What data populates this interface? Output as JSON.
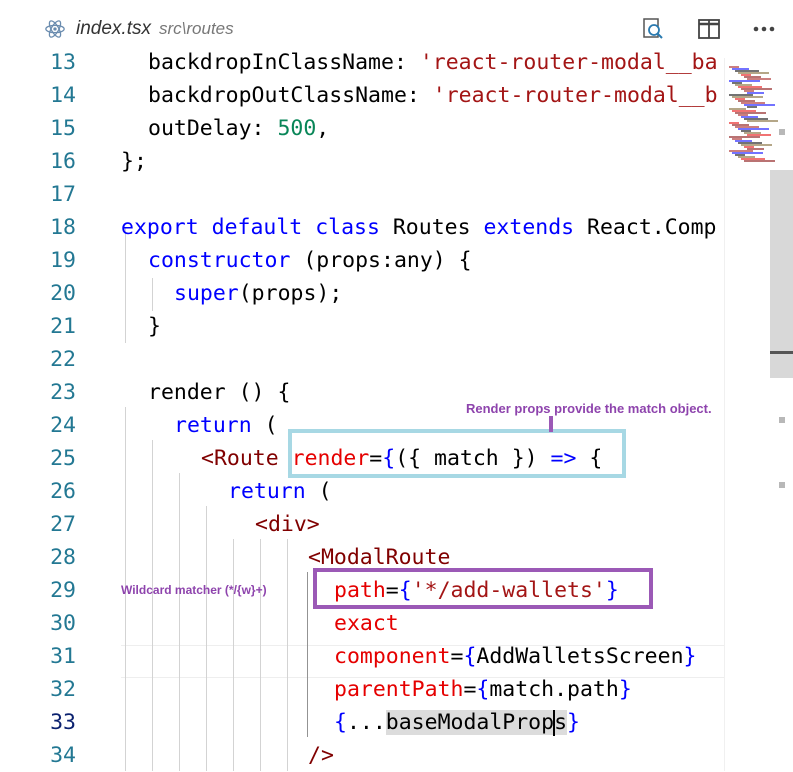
{
  "tab": {
    "filename": "index.tsx",
    "path": "src\\routes",
    "icon": "react-icon"
  },
  "toolbar": {
    "icons": [
      "search-references-icon",
      "split-editor-icon",
      "more-actions-icon"
    ]
  },
  "lines": [
    {
      "n": "13",
      "t": "backdropInClassName: 'react-router-modal__ba"
    },
    {
      "n": "14",
      "t": "backdropOutClassName: 'react-router-modal__b"
    },
    {
      "n": "15",
      "t": "outDelay: 500,"
    },
    {
      "n": "16",
      "t": "};"
    },
    {
      "n": "17",
      "t": ""
    },
    {
      "n": "18",
      "t": "export default class Routes extends React.Comp"
    },
    {
      "n": "19",
      "t": "constructor (props:any) {"
    },
    {
      "n": "20",
      "t": "super(props);"
    },
    {
      "n": "21",
      "t": "}"
    },
    {
      "n": "22",
      "t": ""
    },
    {
      "n": "23",
      "t": "render () {"
    },
    {
      "n": "24",
      "t": "return ("
    },
    {
      "n": "25",
      "t": "<Route render={({ match }) => {"
    },
    {
      "n": "26",
      "t": "return ("
    },
    {
      "n": "27",
      "t": "<div>"
    },
    {
      "n": "28",
      "t": "<ModalRoute"
    },
    {
      "n": "29",
      "t": "path={'*/add-wallets'}"
    },
    {
      "n": "30",
      "t": "exact"
    },
    {
      "n": "31",
      "t": "component={AddWalletsScreen}"
    },
    {
      "n": "32",
      "t": "parentPath={match.path}"
    },
    {
      "n": "33",
      "t": "{...baseModalProps}"
    },
    {
      "n": "34",
      "t": "/>"
    }
  ],
  "annotations": {
    "render_props": "Render props provide the match object.",
    "wildcard": "Wildcard matcher (*/{w}+)"
  },
  "colors": {
    "keyword": "#0000ff",
    "string": "#a31515",
    "number": "#098658",
    "attribute": "#e50000",
    "tag": "#800000",
    "line_number": "#237893",
    "callout_blue": "#a7d8e4",
    "callout_purple": "#9b59b6",
    "annotation_text": "#8e44ad"
  }
}
